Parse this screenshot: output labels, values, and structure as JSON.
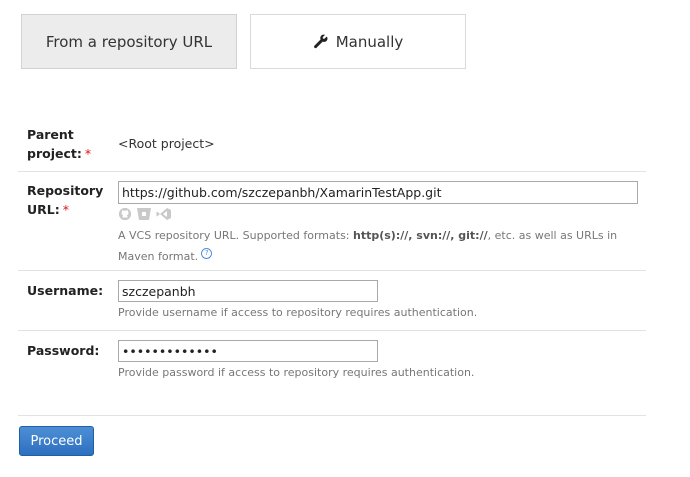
{
  "tabs": {
    "from_url": "From a repository URL",
    "manually": "Manually",
    "manually_icon": "wrench-icon"
  },
  "form": {
    "parent_project": {
      "label": "Parent project:",
      "required_mark": "*",
      "value": "<Root project>"
    },
    "repository_url": {
      "label": "Repository URL:",
      "required_mark": "*",
      "value": "https://github.com/szczepanbh/XamarinTestApp.git",
      "vcs_icons": [
        "github-icon",
        "bitbucket-icon",
        "visual-studio-icon"
      ],
      "note_prefix": "A VCS repository URL. Supported formats: ",
      "note_formats": "http(s)://, svn://, git://",
      "note_suffix": ", etc. as well as URLs in Maven format.",
      "help_icon": "help-icon"
    },
    "username": {
      "label": "Username:",
      "value": "szczepanbh",
      "note": "Provide username if access to repository requires authentication."
    },
    "password": {
      "label": "Password:",
      "value": "•••••••••••••",
      "note": "Provide password if access to repository requires authentication."
    }
  },
  "actions": {
    "proceed": "Proceed"
  },
  "colors": {
    "required": "#dd1111",
    "primary_button": "#2e6fbf",
    "help": "#4a90e2"
  }
}
